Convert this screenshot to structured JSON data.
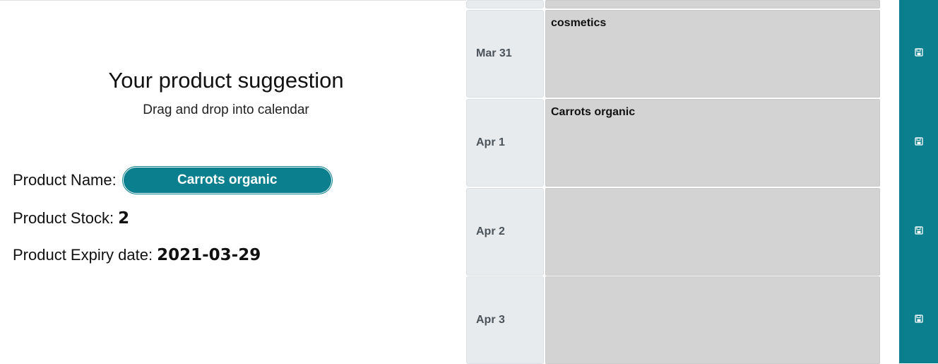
{
  "suggestion": {
    "title": "Your product suggestion",
    "subtitle": "Drag and drop into calendar",
    "name_label": "Product Name:",
    "name_value": "Carrots organic",
    "stock_label": "Product Stock:",
    "stock_value": "2",
    "expiry_label": "Product Expiry date:",
    "expiry_value": "2021-03-29"
  },
  "calendar": {
    "rows": [
      {
        "date": "Mar 31",
        "item": "cosmetics"
      },
      {
        "date": "Apr 1",
        "item": "Carrots organic"
      },
      {
        "date": "Apr 2",
        "item": ""
      },
      {
        "date": "Apr 3",
        "item": ""
      }
    ]
  },
  "save_bar": {
    "icon": "floppy-disk-icon",
    "color": "#0b7f8d"
  },
  "colors": {
    "accent": "#0b7f8d",
    "slot_bg": "#d3d3d3",
    "date_bg": "#e8ebee"
  }
}
